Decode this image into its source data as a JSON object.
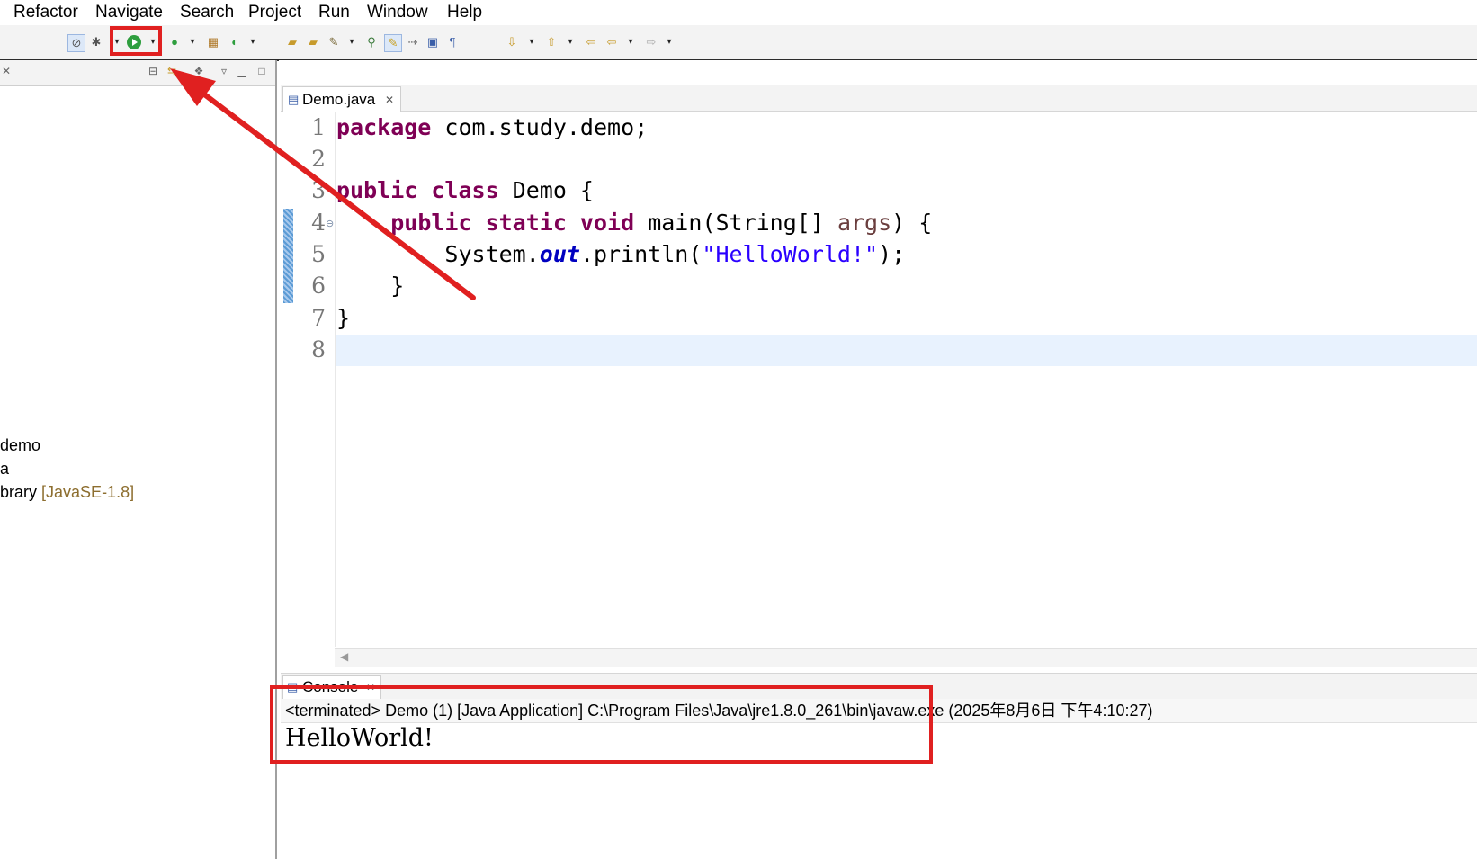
{
  "menu": [
    "Refactor",
    "Navigate",
    "Search",
    "Project",
    "Run",
    "Window",
    "Help"
  ],
  "toolbar": {
    "run_icon": "play-icon",
    "dropdown_glyph": "▾"
  },
  "package_explorer": {
    "close_glyph": "✕",
    "tree": [
      {
        "label": "demo",
        "suffix": ""
      },
      {
        "label": "a",
        "suffix": ""
      },
      {
        "label": "brary",
        "suffix": "[JavaSE-1.8]"
      }
    ]
  },
  "editor": {
    "tab_label": "Demo.java",
    "tab_close": "✕",
    "line_numbers": [
      "1",
      "2",
      "3",
      "4",
      "5",
      "6",
      "7",
      "8"
    ],
    "code": {
      "l1_kw": "package",
      "l1_rest": " com.study.demo;",
      "l3_kw": "public class",
      "l3_rest": " Demo {",
      "l4_indent": "    ",
      "l4_kw": "public static void",
      "l4_mid": " main(String[] ",
      "l4_arg": "args",
      "l4_end": ") {",
      "l5_indent": "        System.",
      "l5_field": "out",
      "l5_mid": ".println(",
      "l5_str": "\"HelloWorld!\"",
      "l5_end": ");",
      "l6": "    }",
      "l7": "}"
    },
    "fold_glyph": "⊖",
    "scroll_left_glyph": "◀"
  },
  "console": {
    "tab_label": "Console",
    "tab_close": "✕",
    "status": "<terminated> Demo (1) [Java Application] C:\\Program Files\\Java\\jre1.8.0_261\\bin\\javaw.exe (2025年8月6日 下午4:10:27)",
    "output": "HelloWorld!"
  },
  "colors": {
    "keyword": "#7f0055",
    "string": "#2a00ff",
    "field": "#0000c0",
    "annotation": "#e02020",
    "highlight_line": "#e8f2fe"
  }
}
